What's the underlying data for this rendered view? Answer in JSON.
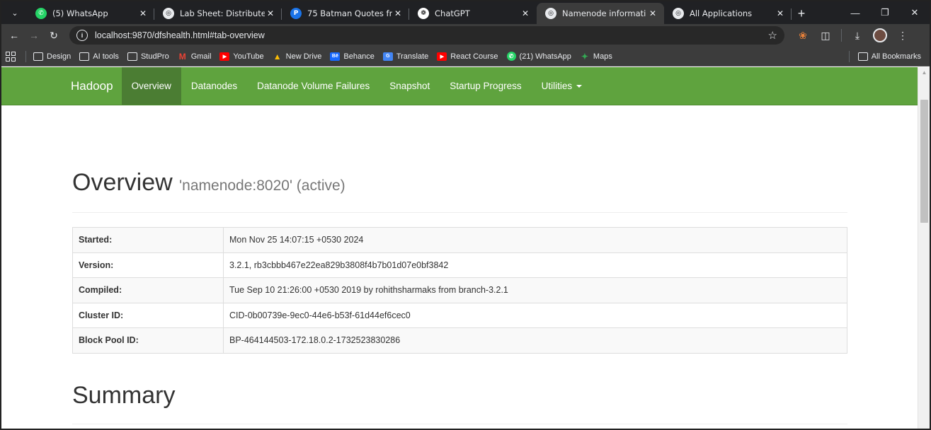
{
  "browser": {
    "tabs": [
      {
        "title": "(5) WhatsApp",
        "favicon": "whatsapp-icon",
        "active": false
      },
      {
        "title": "Lab Sheet: Distributed",
        "favicon": "globe-icon",
        "active": false
      },
      {
        "title": "75 Batman Quotes fro",
        "favicon": "p-icon",
        "active": false
      },
      {
        "title": "ChatGPT",
        "favicon": "chatgpt-icon",
        "active": false
      },
      {
        "title": "Namenode informati",
        "favicon": "globe-icon",
        "active": true
      },
      {
        "title": "All Applications",
        "favicon": "globe-icon",
        "active": false
      }
    ],
    "url": "localhost:9870/dfshealth.html#tab-overview",
    "bookmarks": [
      {
        "label": "Design",
        "icon": "folder-icon"
      },
      {
        "label": "AI tools",
        "icon": "folder-icon"
      },
      {
        "label": "StudPro",
        "icon": "folder-icon"
      },
      {
        "label": "Gmail",
        "icon": "gmail-icon"
      },
      {
        "label": "YouTube",
        "icon": "youtube-icon"
      },
      {
        "label": "New Drive",
        "icon": "drive-icon"
      },
      {
        "label": "Behance",
        "icon": "behance-icon"
      },
      {
        "label": "Translate",
        "icon": "translate-icon"
      },
      {
        "label": "React Course",
        "icon": "youtube-icon"
      },
      {
        "label": "(21) WhatsApp",
        "icon": "whatsapp-icon"
      },
      {
        "label": "Maps",
        "icon": "maps-icon"
      }
    ],
    "all_bookmarks": "All Bookmarks"
  },
  "navbar": {
    "brand": "Hadoop",
    "items": [
      "Overview",
      "Datanodes",
      "Datanode Volume Failures",
      "Snapshot",
      "Startup Progress",
      "Utilities"
    ],
    "active": "Overview",
    "color": "#5fa33e"
  },
  "overview": {
    "title": "Overview",
    "subtitle": "'namenode:8020' (active)",
    "rows": [
      {
        "key": "Started:",
        "value": "Mon Nov 25 14:07:15 +0530 2024"
      },
      {
        "key": "Version:",
        "value": "3.2.1, rb3cbbb467e22ea829b3808f4b7b01d07e0bf3842"
      },
      {
        "key": "Compiled:",
        "value": "Tue Sep 10 21:26:00 +0530 2019 by rohithsharmaks from branch-3.2.1"
      },
      {
        "key": "Cluster ID:",
        "value": "CID-0b00739e-9ec0-44e6-b53f-61d44ef6cec0"
      },
      {
        "key": "Block Pool ID:",
        "value": "BP-464144503-172.18.0.2-1732523830286"
      }
    ]
  },
  "summary": {
    "title": "Summary"
  }
}
